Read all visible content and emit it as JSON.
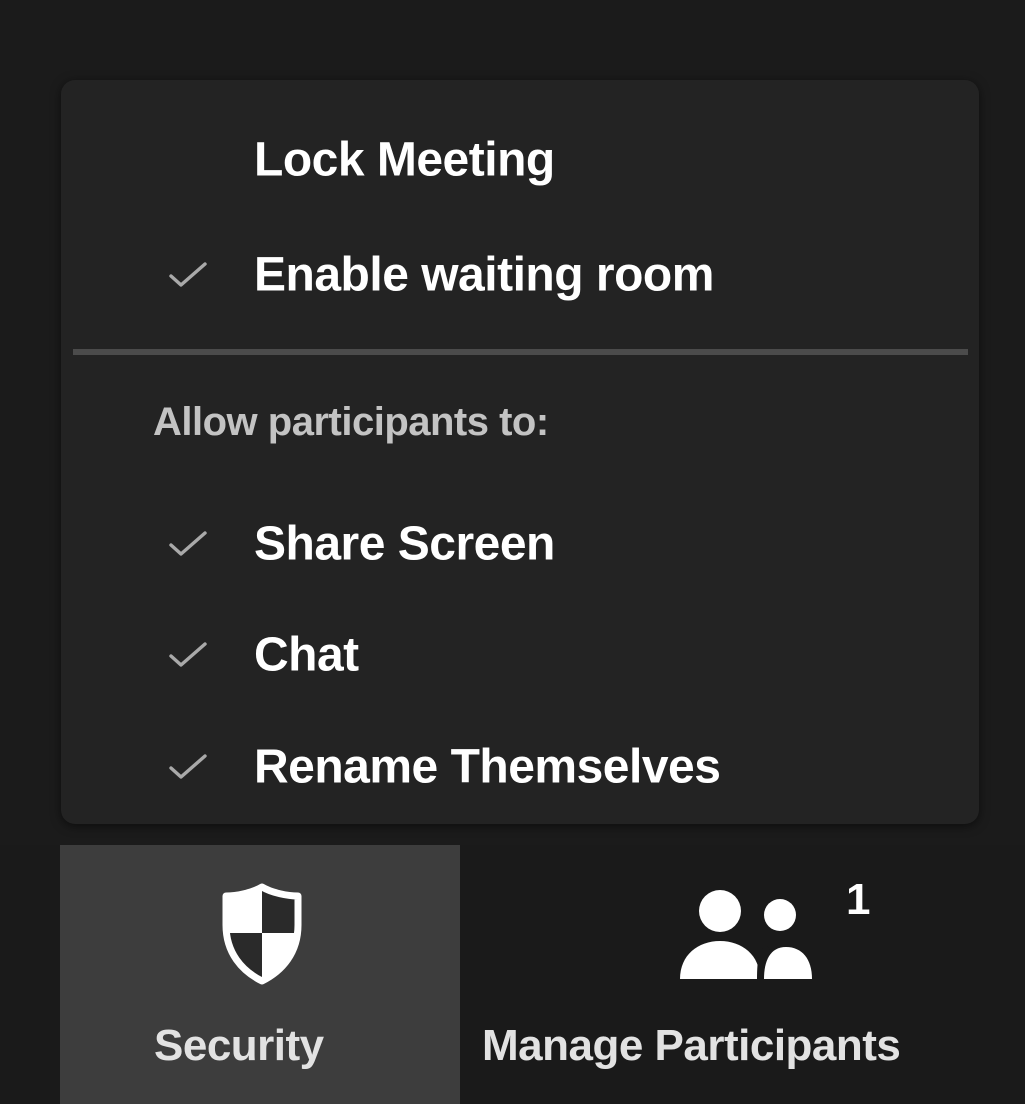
{
  "menu": {
    "items": [
      {
        "label": "Lock Meeting",
        "checked": false
      },
      {
        "label": "Enable waiting room",
        "checked": true
      }
    ],
    "section_header": "Allow participants to:",
    "permissions": [
      {
        "label": "Share Screen",
        "checked": true
      },
      {
        "label": "Chat",
        "checked": true
      },
      {
        "label": "Rename Themselves",
        "checked": true
      }
    ],
    "check_icon": "checkmark-icon"
  },
  "toolbar": {
    "security": {
      "label": "Security",
      "icon": "shield-icon",
      "active": true
    },
    "participants": {
      "label": "Manage Participants",
      "icon": "participants-icon",
      "count": "1"
    }
  },
  "colors": {
    "background": "#1a1a1a",
    "menu_bg": "#232323",
    "active_button_bg": "#3d3d3d",
    "text": "#ffffff",
    "muted_text": "#c3c3c3",
    "checkmark": "#a9a9a9"
  }
}
